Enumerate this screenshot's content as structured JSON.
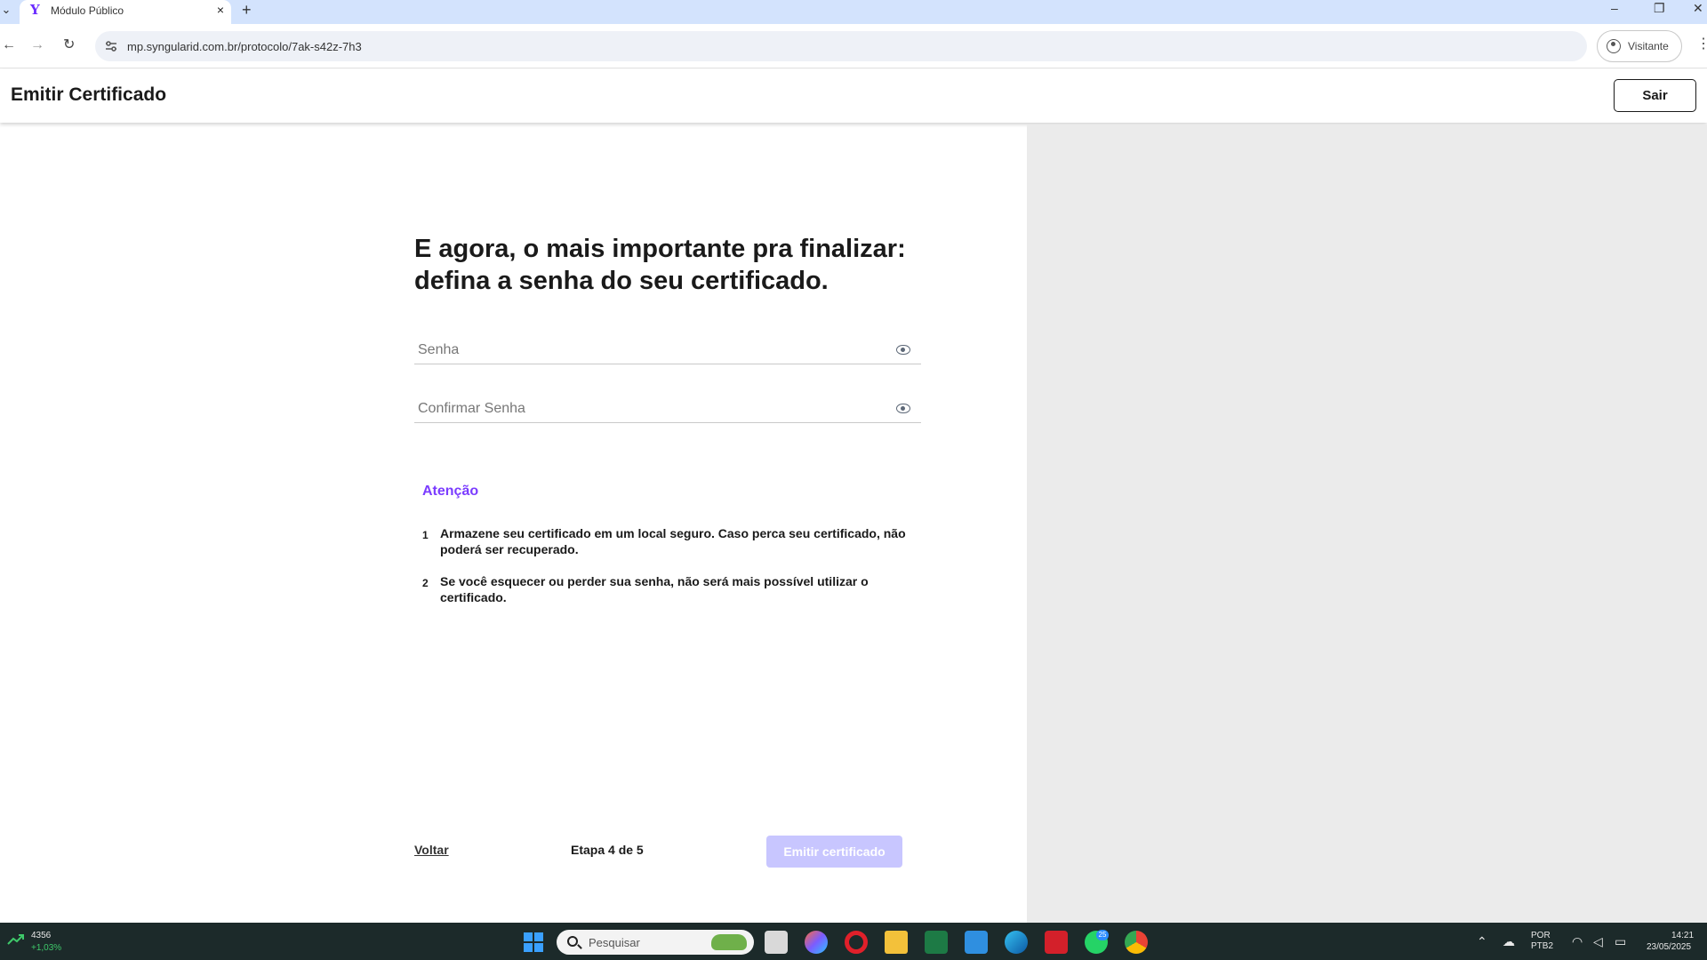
{
  "browser": {
    "tab_title": "Módulo Público",
    "tab_close": "×",
    "new_tab": "+",
    "url": "mp.syngularid.com.br/protocolo/7ak-s42z-7h3",
    "profile_label": "Visitante",
    "minimize": "–",
    "restore": "❐",
    "close": "✕"
  },
  "header": {
    "title": "Emitir Certificado",
    "exit_label": "Sair"
  },
  "form": {
    "heading": "E agora, o mais importante pra finalizar: defina a senha do seu certificado.",
    "password_placeholder": "Senha",
    "confirm_placeholder": "Confirmar Senha"
  },
  "attention": {
    "title": "Atenção",
    "items": [
      {
        "num": "1",
        "text": "Armazene seu certificado em um local seguro. Caso perca seu certificado, não poderá ser recuperado."
      },
      {
        "num": "2",
        "text": "Se você esquecer ou perder sua senha, não será mais possível utilizar o certificado."
      }
    ]
  },
  "footer": {
    "back_label": "Voltar",
    "step_text": "Etapa 4 de 5",
    "submit_label": "Emitir certificado"
  },
  "taskbar": {
    "stock_value": "4356",
    "stock_change": "+1,03%",
    "search_placeholder": "Pesquisar",
    "whatsapp_badge": "25",
    "lang_line1": "POR",
    "lang_line2": "PTB2",
    "time": "14:21",
    "date": "23/05/2025"
  },
  "colors": {
    "accent": "#7b3cff",
    "button_disabled": "#c8c6ff",
    "side_panel": "#ebebeb",
    "taskbar": "#1c2a2a"
  }
}
